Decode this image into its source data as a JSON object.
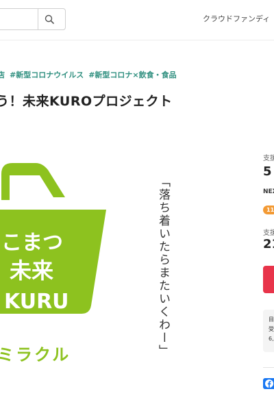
{
  "header": {
    "search_placeholder": "",
    "nav_label": "クラウドファンディ"
  },
  "tags": [
    "#新型コロナウイルス",
    "#新型コロナ×飲食・食品"
  ],
  "tag_fragment": "店",
  "title": "う！未来KUROプロジェクト",
  "visual": {
    "logo_lines": [
      "こまつ",
      "未来",
      "KURU"
    ],
    "subline": "ミラクル",
    "vertical_text": "「落ち着いたらまたいくわー」"
  },
  "sidebar": {
    "support_label_1": "支援",
    "amount_partial": "5",
    "next_label": "NEX",
    "badge": "11",
    "support_label_2": "支援",
    "supporters_partial": "21",
    "info_lines": [
      "目",
      "受",
      "6,"
    ],
    "colors": {
      "accent": "#e8344a",
      "badge": "#f39a34",
      "facebook": "#1877f2",
      "logo_green": "#8dc21f",
      "tag": "#2f8f7f"
    }
  }
}
